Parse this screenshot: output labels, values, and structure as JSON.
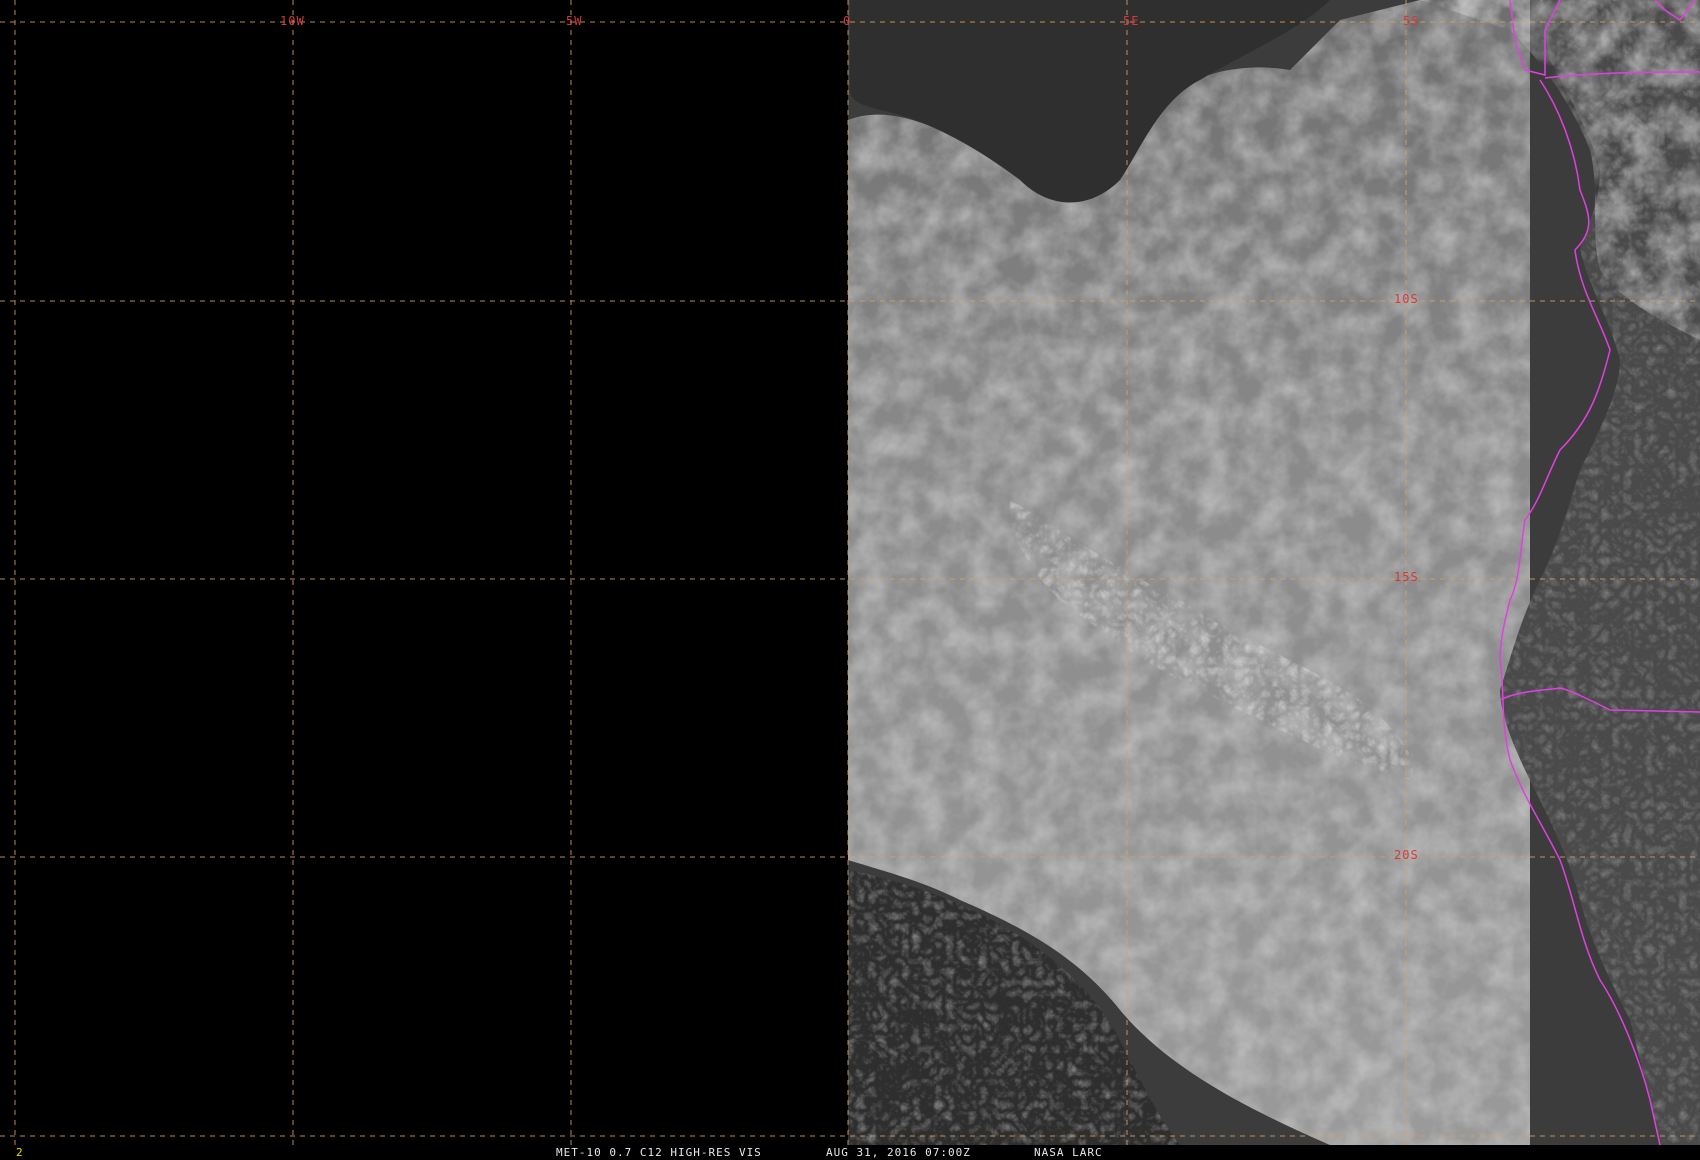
{
  "map": {
    "lon_labels": [
      "10W",
      "5W",
      "0",
      "5E",
      "5S"
    ],
    "lat_labels": [
      "10S",
      "15S",
      "20S"
    ],
    "graticule_color": "#d9a066",
    "label_color": "#d23b3b",
    "boundary_color": "#e040e0"
  },
  "status": {
    "frame_number": "2",
    "product": "MET-10 0.7 C12 HIGH-RES VIS",
    "datetime": "AUG 31, 2016 07:00Z",
    "source": "NASA LARC"
  }
}
